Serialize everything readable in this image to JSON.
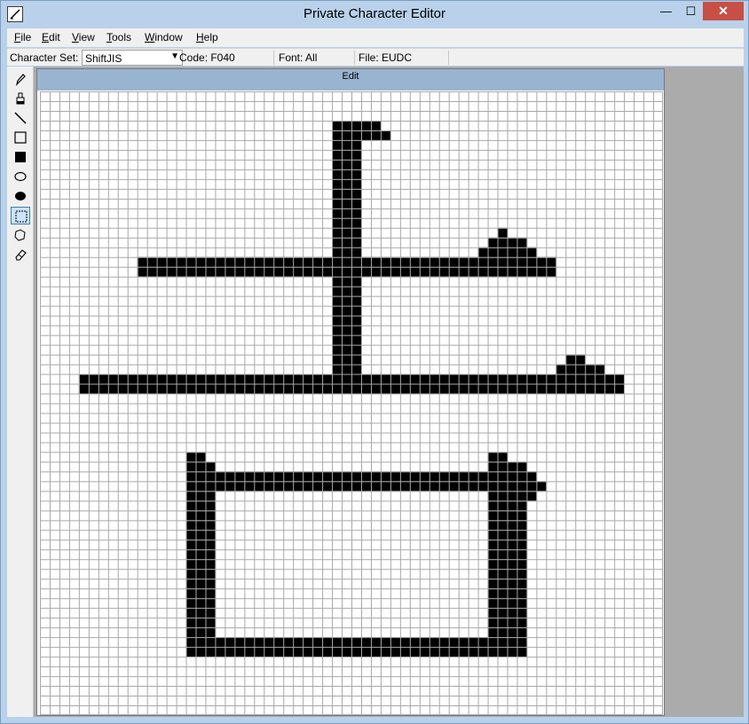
{
  "window": {
    "title": "Private Character Editor",
    "minimize_glyph": "—",
    "maximize_glyph": "☐",
    "close_glyph": "✕"
  },
  "menu": [
    {
      "label": "File",
      "accel": "F",
      "rest": "ile"
    },
    {
      "label": "Edit",
      "accel": "E",
      "rest": "dit"
    },
    {
      "label": "View",
      "accel": "V",
      "rest": "iew"
    },
    {
      "label": "Tools",
      "accel": "T",
      "rest": "ools"
    },
    {
      "label": "Window",
      "accel": "W",
      "rest": "indow"
    },
    {
      "label": "Help",
      "accel": "H",
      "rest": "elp"
    }
  ],
  "infobar": {
    "charset_label": "Character Set:",
    "charset_value": "ShiftJIS",
    "code": "Code: F040",
    "font": "Font: All",
    "file": "File: EUDC"
  },
  "tools": [
    {
      "icon": "pencil-icon",
      "selected": false
    },
    {
      "icon": "brush-icon",
      "selected": false
    },
    {
      "icon": "line-icon",
      "selected": false
    },
    {
      "icon": "hollow-rectangle-icon",
      "selected": false
    },
    {
      "icon": "filled-rectangle-icon",
      "selected": false
    },
    {
      "icon": "hollow-ellipse-icon",
      "selected": false
    },
    {
      "icon": "filled-ellipse-icon",
      "selected": false
    },
    {
      "icon": "rectangular-selection-icon",
      "selected": true
    },
    {
      "icon": "freeform-selection-icon",
      "selected": false
    },
    {
      "icon": "eraser-icon",
      "selected": false
    }
  ],
  "editor": {
    "title": "Edit",
    "grid_size": 64,
    "colors": {
      "grid_line": "#a8a8a8",
      "filled": "#000000",
      "titlebar": "#99b4d1"
    },
    "filled_runs": [
      [
        3,
        30,
        34
      ],
      [
        4,
        30,
        35
      ],
      [
        5,
        30,
        32
      ],
      [
        6,
        30,
        32
      ],
      [
        7,
        30,
        32
      ],
      [
        8,
        30,
        32
      ],
      [
        9,
        30,
        32
      ],
      [
        10,
        30,
        32
      ],
      [
        11,
        30,
        32
      ],
      [
        12,
        30,
        32
      ],
      [
        13,
        30,
        32
      ],
      [
        14,
        30,
        32
      ],
      [
        14,
        47,
        47
      ],
      [
        15,
        30,
        32
      ],
      [
        15,
        46,
        49
      ],
      [
        16,
        30,
        32
      ],
      [
        16,
        45,
        50
      ],
      [
        17,
        10,
        52
      ],
      [
        18,
        10,
        52
      ],
      [
        19,
        30,
        32
      ],
      [
        20,
        30,
        32
      ],
      [
        21,
        30,
        32
      ],
      [
        22,
        30,
        32
      ],
      [
        23,
        30,
        32
      ],
      [
        24,
        30,
        32
      ],
      [
        25,
        30,
        32
      ],
      [
        26,
        30,
        32
      ],
      [
        27,
        30,
        32
      ],
      [
        27,
        54,
        55
      ],
      [
        28,
        30,
        32
      ],
      [
        28,
        53,
        57
      ],
      [
        29,
        4,
        59
      ],
      [
        30,
        4,
        59
      ],
      [
        37,
        15,
        16
      ],
      [
        37,
        46,
        47
      ],
      [
        38,
        15,
        17
      ],
      [
        38,
        46,
        49
      ],
      [
        39,
        15,
        50
      ],
      [
        40,
        15,
        51
      ],
      [
        41,
        15,
        17
      ],
      [
        41,
        46,
        50
      ],
      [
        42,
        15,
        17
      ],
      [
        42,
        46,
        49
      ],
      [
        43,
        15,
        17
      ],
      [
        43,
        46,
        49
      ],
      [
        44,
        15,
        17
      ],
      [
        44,
        46,
        49
      ],
      [
        45,
        15,
        17
      ],
      [
        45,
        46,
        49
      ],
      [
        46,
        15,
        17
      ],
      [
        46,
        46,
        49
      ],
      [
        47,
        15,
        17
      ],
      [
        47,
        46,
        49
      ],
      [
        48,
        15,
        17
      ],
      [
        48,
        46,
        49
      ],
      [
        49,
        15,
        17
      ],
      [
        49,
        46,
        49
      ],
      [
        50,
        15,
        17
      ],
      [
        50,
        46,
        49
      ],
      [
        51,
        15,
        17
      ],
      [
        51,
        46,
        49
      ],
      [
        52,
        15,
        17
      ],
      [
        52,
        46,
        49
      ],
      [
        53,
        15,
        17
      ],
      [
        53,
        46,
        49
      ],
      [
        54,
        15,
        17
      ],
      [
        54,
        46,
        49
      ],
      [
        55,
        15,
        17
      ],
      [
        55,
        46,
        49
      ],
      [
        56,
        15,
        49
      ],
      [
        57,
        15,
        49
      ]
    ]
  }
}
